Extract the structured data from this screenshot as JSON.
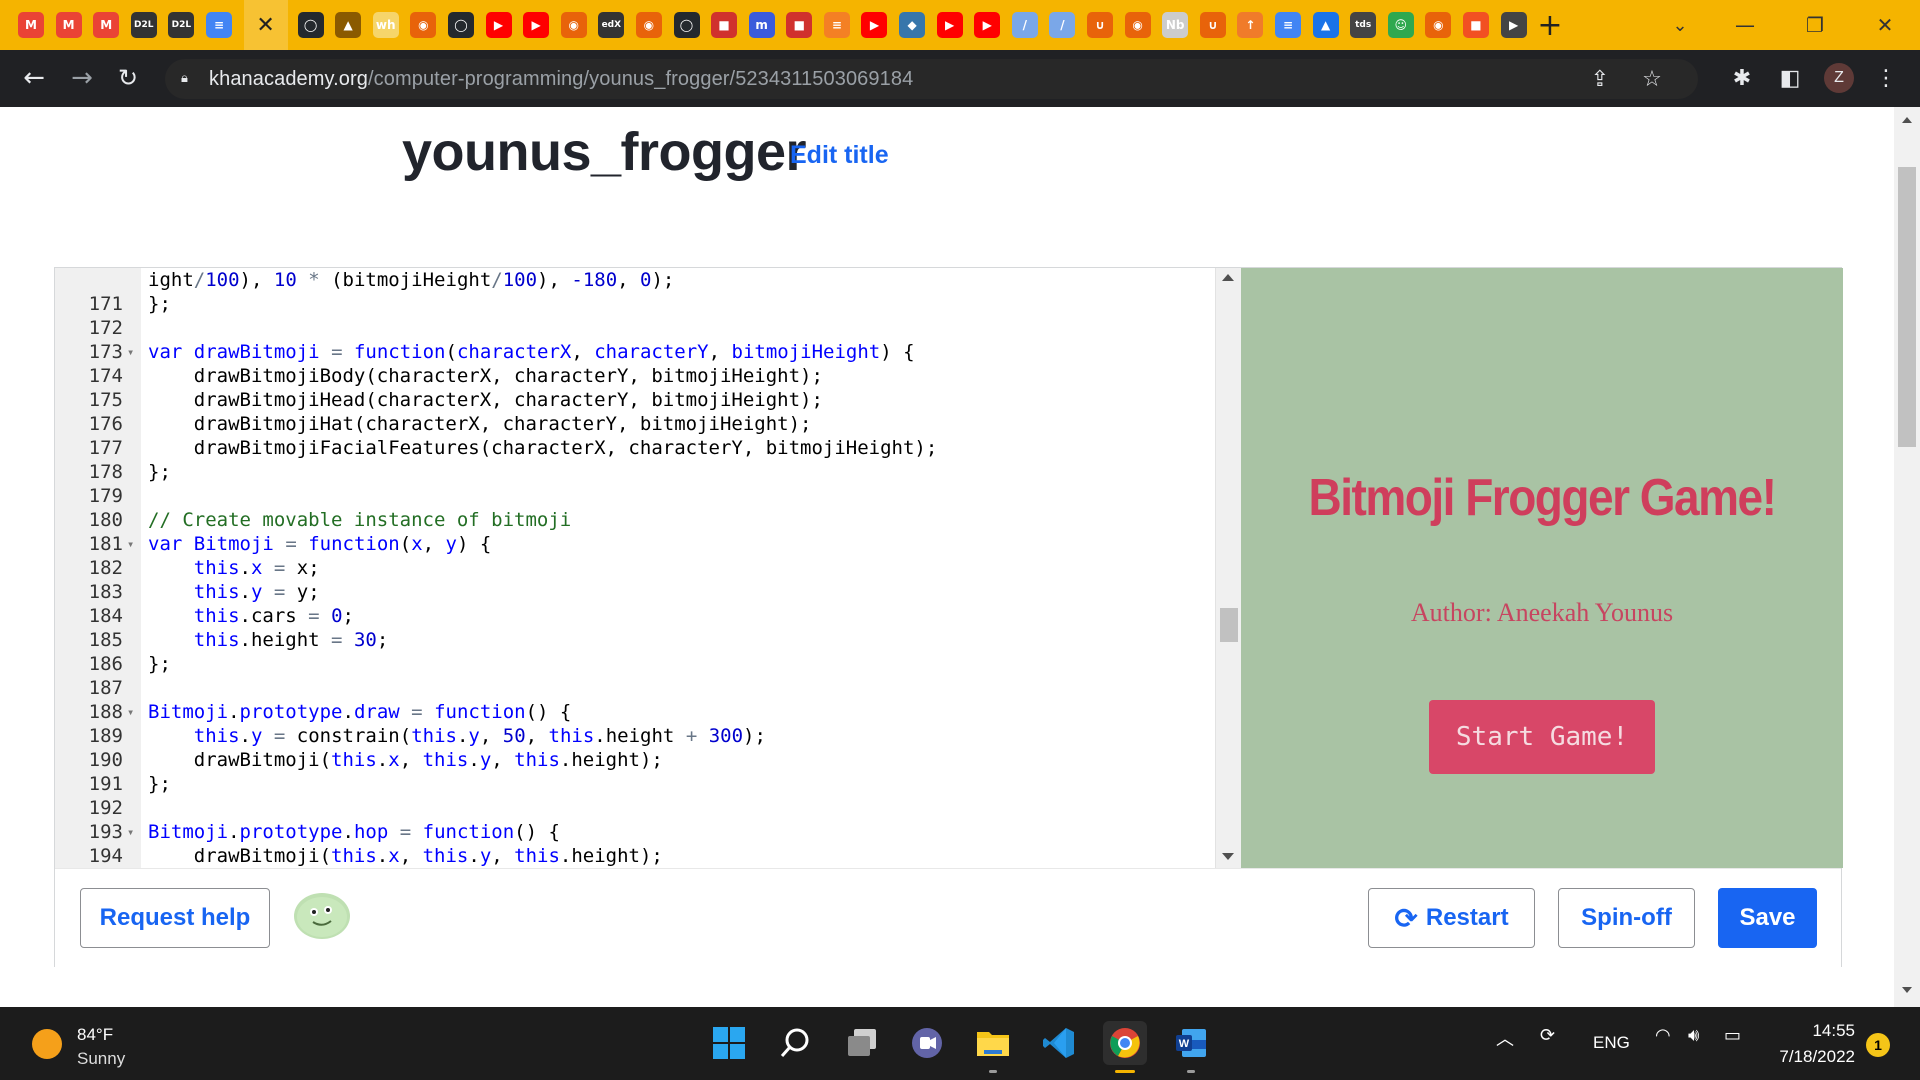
{
  "browser": {
    "active_tab_close": "✕",
    "new_tab": "+",
    "url_host": "khanacademy.org",
    "url_path": "/computer-programming/younus_frogger/5234311503069184",
    "profile_initial": "Z",
    "tabs": [
      {
        "icon": "gmail-icon",
        "label": "M",
        "color": "#ea4335"
      },
      {
        "icon": "gmail-icon",
        "label": "M",
        "color": "#ea4335"
      },
      {
        "icon": "gmail-icon",
        "label": "M",
        "color": "#ea4335"
      },
      {
        "icon": "d2l-icon",
        "label": "D2L",
        "color": "#333333"
      },
      {
        "icon": "d2l-icon",
        "label": "D2L",
        "color": "#333333"
      },
      {
        "icon": "google-docs-icon",
        "label": "≡",
        "color": "#4285f4"
      },
      {
        "icon": "github-icon",
        "label": "◯",
        "color": "#24292e"
      },
      {
        "icon": "drive-icon",
        "label": "▲",
        "color": "#8a5a00"
      },
      {
        "icon": "wh-icon",
        "label": "wh",
        "color": "#f6d56a"
      },
      {
        "icon": "chrome-icon",
        "label": "◉",
        "color": "#e8630a"
      },
      {
        "icon": "github-icon",
        "label": "◯",
        "color": "#24292e"
      },
      {
        "icon": "youtube-icon",
        "label": "▶",
        "color": "#ff0000"
      },
      {
        "icon": "youtube-icon",
        "label": "▶",
        "color": "#ff0000"
      },
      {
        "icon": "chrome-icon",
        "label": "◉",
        "color": "#e8630a"
      },
      {
        "icon": "edx-icon",
        "label": "edX",
        "color": "#333333"
      },
      {
        "icon": "chrome-icon",
        "label": "◉",
        "color": "#e8630a"
      },
      {
        "icon": "github-icon",
        "label": "◯",
        "color": "#24292e"
      },
      {
        "icon": "app-icon",
        "label": "■",
        "color": "#d0312d"
      },
      {
        "icon": "m-icon",
        "label": "m",
        "color": "#3b5bdb"
      },
      {
        "icon": "app-icon",
        "label": "■",
        "color": "#d0312d"
      },
      {
        "icon": "stack-icon",
        "label": "≡",
        "color": "#f48024"
      },
      {
        "icon": "youtube-icon",
        "label": "▶",
        "color": "#ff0000"
      },
      {
        "icon": "python-icon",
        "label": "◆",
        "color": "#3776ab"
      },
      {
        "icon": "youtube-icon",
        "label": "▶",
        "color": "#ff0000"
      },
      {
        "icon": "youtube-icon",
        "label": "▶",
        "color": "#ff0000"
      },
      {
        "icon": "pen-icon",
        "label": "/",
        "color": "#7aa7e8"
      },
      {
        "icon": "pen-icon",
        "label": "/",
        "color": "#7aa7e8"
      },
      {
        "icon": "loop-icon",
        "label": "∪",
        "color": "#e8630a"
      },
      {
        "icon": "chrome-icon",
        "label": "◉",
        "color": "#e8630a"
      },
      {
        "icon": "nb-icon",
        "label": "Nb",
        "color": "#cccccc"
      },
      {
        "icon": "loop-icon",
        "label": "∪",
        "color": "#e8630a"
      },
      {
        "icon": "arrow-icon",
        "label": "↑",
        "color": "#f07b2a"
      },
      {
        "icon": "google-docs-icon",
        "label": "≡",
        "color": "#4285f4"
      },
      {
        "icon": "flask-icon",
        "label": "▲",
        "color": "#1a73e8"
      },
      {
        "icon": "tds-icon",
        "label": "tds",
        "color": "#444444"
      },
      {
        "icon": "smiley-icon",
        "label": "☺",
        "color": "#2fa84f"
      },
      {
        "icon": "chrome-icon",
        "label": "◉",
        "color": "#e8630a"
      },
      {
        "icon": "microsoft-icon",
        "label": "■",
        "color": "#f25022"
      },
      {
        "icon": "forward-icon",
        "label": "▶",
        "color": "#444444"
      }
    ]
  },
  "page": {
    "title": "younus_frogger",
    "edit_title": "Edit title"
  },
  "code_lines": [
    {
      "n": "",
      "fold": false,
      "html": "ight<span class=\"op\">/</span><span class=\"num\">100</span>), <span class=\"num\">10</span> <span class=\"op\">*</span> (bitmojiHeight<span class=\"op\">/</span><span class=\"num\">100</span>), <span class=\"num\">-180</span>, <span class=\"num\">0</span>);"
    },
    {
      "n": "171",
      "fold": false,
      "html": "};"
    },
    {
      "n": "172",
      "fold": false,
      "html": ""
    },
    {
      "n": "173",
      "fold": true,
      "html": "<span class=\"kw\">var</span> <span class=\"fn\">drawBitmoji</span> <span class=\"op\">=</span> <span class=\"kw\">function</span>(<span class=\"fn\">characterX</span>, <span class=\"fn\">characterY</span>, <span class=\"fn\">bitmojiHeight</span>) {"
    },
    {
      "n": "174",
      "fold": false,
      "html": "    drawBitmojiBody(characterX, characterY, bitmojiHeight);"
    },
    {
      "n": "175",
      "fold": false,
      "html": "    drawBitmojiHead(characterX, characterY, bitmojiHeight);"
    },
    {
      "n": "176",
      "fold": false,
      "html": "    drawBitmojiHat(characterX, characterY, bitmojiHeight);"
    },
    {
      "n": "177",
      "fold": false,
      "html": "    drawBitmojiFacialFeatures(characterX, characterY, bitmojiHeight);"
    },
    {
      "n": "178",
      "fold": false,
      "html": "};"
    },
    {
      "n": "179",
      "fold": false,
      "html": ""
    },
    {
      "n": "180",
      "fold": false,
      "html": "<span class=\"cm\">// Create movable instance of bitmoji</span>"
    },
    {
      "n": "181",
      "fold": true,
      "html": "<span class=\"kw\">var</span> <span class=\"fn\">Bitmoji</span> <span class=\"op\">=</span> <span class=\"kw\">function</span>(<span class=\"fn\">x</span>, <span class=\"fn\">y</span>) {"
    },
    {
      "n": "182",
      "fold": false,
      "html": "    <span class=\"kw\">this</span>.<span class=\"fn\">x</span> <span class=\"op\">=</span> x;"
    },
    {
      "n": "183",
      "fold": false,
      "html": "    <span class=\"kw\">this</span>.<span class=\"fn\">y</span> <span class=\"op\">=</span> y;"
    },
    {
      "n": "184",
      "fold": false,
      "html": "    <span class=\"kw\">this</span>.cars <span class=\"op\">=</span> <span class=\"num\">0</span>;"
    },
    {
      "n": "185",
      "fold": false,
      "html": "    <span class=\"kw\">this</span>.height <span class=\"op\">=</span> <span class=\"num\">30</span>;"
    },
    {
      "n": "186",
      "fold": false,
      "html": "};"
    },
    {
      "n": "187",
      "fold": false,
      "html": ""
    },
    {
      "n": "188",
      "fold": true,
      "html": "<span class=\"fn\">Bitmoji</span>.<span class=\"fn\">prototype</span>.<span class=\"fn\">draw</span> <span class=\"op\">=</span> <span class=\"kw\">function</span>() {"
    },
    {
      "n": "189",
      "fold": false,
      "html": "    <span class=\"kw\">this</span>.<span class=\"fn\">y</span> <span class=\"op\">=</span> constrain(<span class=\"kw\">this</span>.<span class=\"fn\">y</span>, <span class=\"num\">50</span>, <span class=\"kw\">this</span>.height <span class=\"op\">+</span> <span class=\"num\">300</span>);"
    },
    {
      "n": "190",
      "fold": false,
      "html": "    drawBitmoji(<span class=\"kw\">this</span>.<span class=\"fn\">x</span>, <span class=\"kw\">this</span>.<span class=\"fn\">y</span>, <span class=\"kw\">this</span>.height);"
    },
    {
      "n": "191",
      "fold": false,
      "html": "};"
    },
    {
      "n": "192",
      "fold": false,
      "html": ""
    },
    {
      "n": "193",
      "fold": true,
      "html": "<span class=\"fn\">Bitmoji</span>.<span class=\"fn\">prototype</span>.<span class=\"fn\">hop</span> <span class=\"op\">=</span> <span class=\"kw\">function</span>() {"
    },
    {
      "n": "194",
      "fold": false,
      "html": "    drawBitmoji(<span class=\"kw\">this</span>.<span class=\"fn\">x</span>, <span class=\"kw\">this</span>.<span class=\"fn\">y</span>, <span class=\"kw\">this</span>.height);"
    }
  ],
  "canvas": {
    "title": "Bitmoji Frogger Game!",
    "author": "Author: Aneekah Younus",
    "start_button": "Start Game!",
    "background": "#a9c3a4",
    "title_color": "#cf3e5c"
  },
  "actions": {
    "request_help": "Request help",
    "restart": "Restart",
    "spin_off": "Spin-off",
    "save": "Save"
  },
  "taskbar": {
    "weather_temp": "84°F",
    "weather_desc": "Sunny",
    "language": "ENG",
    "time": "14:55",
    "date": "7/18/2022",
    "notification_count": "1"
  }
}
